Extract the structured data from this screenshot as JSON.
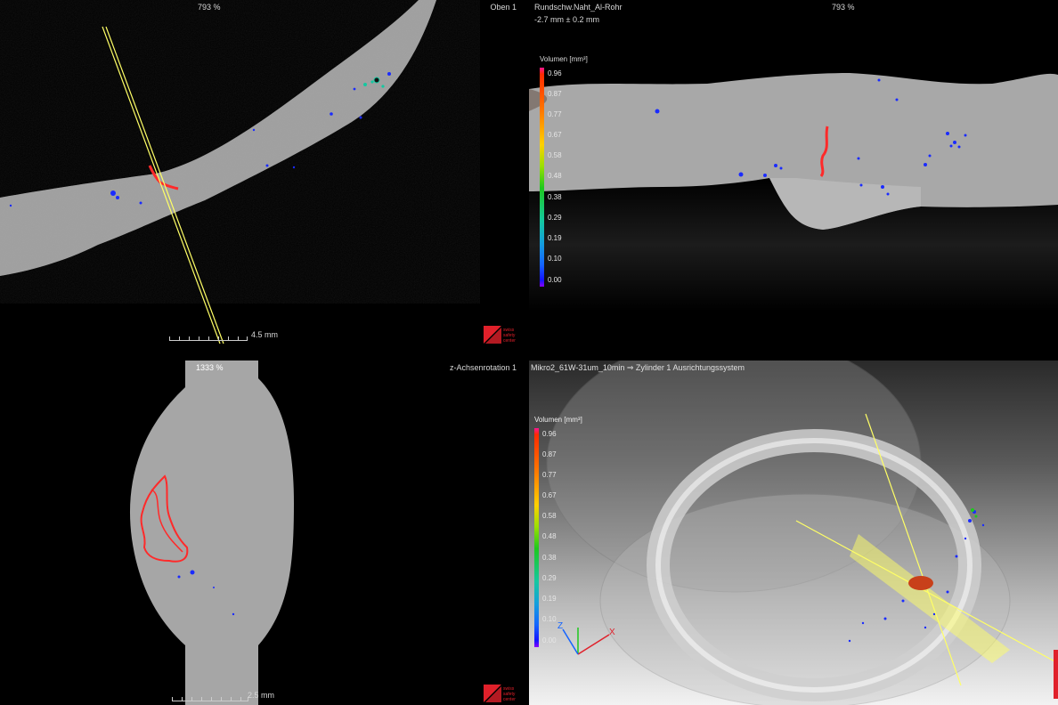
{
  "top_left": {
    "zoom_label": "793 %",
    "view_label": "Oben 1",
    "scale_label": "4.5 mm"
  },
  "top_right": {
    "title": "Rundschw.Naht_Al-Rohr",
    "subtitle": "-2.7 mm ± 0.2 mm",
    "zoom_label": "793 %",
    "legend": {
      "title": "Volumen [mm³]",
      "ticks": [
        "0.96",
        "0.87",
        "0.77",
        "0.67",
        "0.58",
        "0.48",
        "0.38",
        "0.29",
        "0.19",
        "0.10",
        "0.00"
      ]
    }
  },
  "bottom_left": {
    "zoom_label": "1333 %",
    "view_label": "z-Achsenrotation 1",
    "scale_label": "2.5 mm"
  },
  "bottom_right": {
    "title": "Mikro2_61W-31um_10min ⇒ Zylinder 1 Ausrichtungssystem",
    "legend": {
      "title": "Volumen [mm³]",
      "ticks": [
        "0.96",
        "0.87",
        "0.77",
        "0.67",
        "0.58",
        "0.48",
        "0.38",
        "0.29",
        "0.19",
        "0.10",
        "0.00"
      ]
    },
    "axis_labels": {
      "x": "X",
      "z": "Z"
    }
  },
  "colors": {
    "legend_gradient": [
      "#ff1493",
      "#ff2a00",
      "#ff7a00",
      "#ffd000",
      "#9be000",
      "#1ec81e",
      "#14c8a0",
      "#14a0dc",
      "#1464ff",
      "#1414ff",
      "#8a00ff"
    ],
    "pore_blue": "#1a2bff",
    "defect_red": "#ff2a2a",
    "guide_yellow": "#ffff66",
    "logo_red": "#e0202a"
  },
  "branding": {
    "logo_lines": [
      "swiss",
      "safety",
      "center"
    ]
  }
}
